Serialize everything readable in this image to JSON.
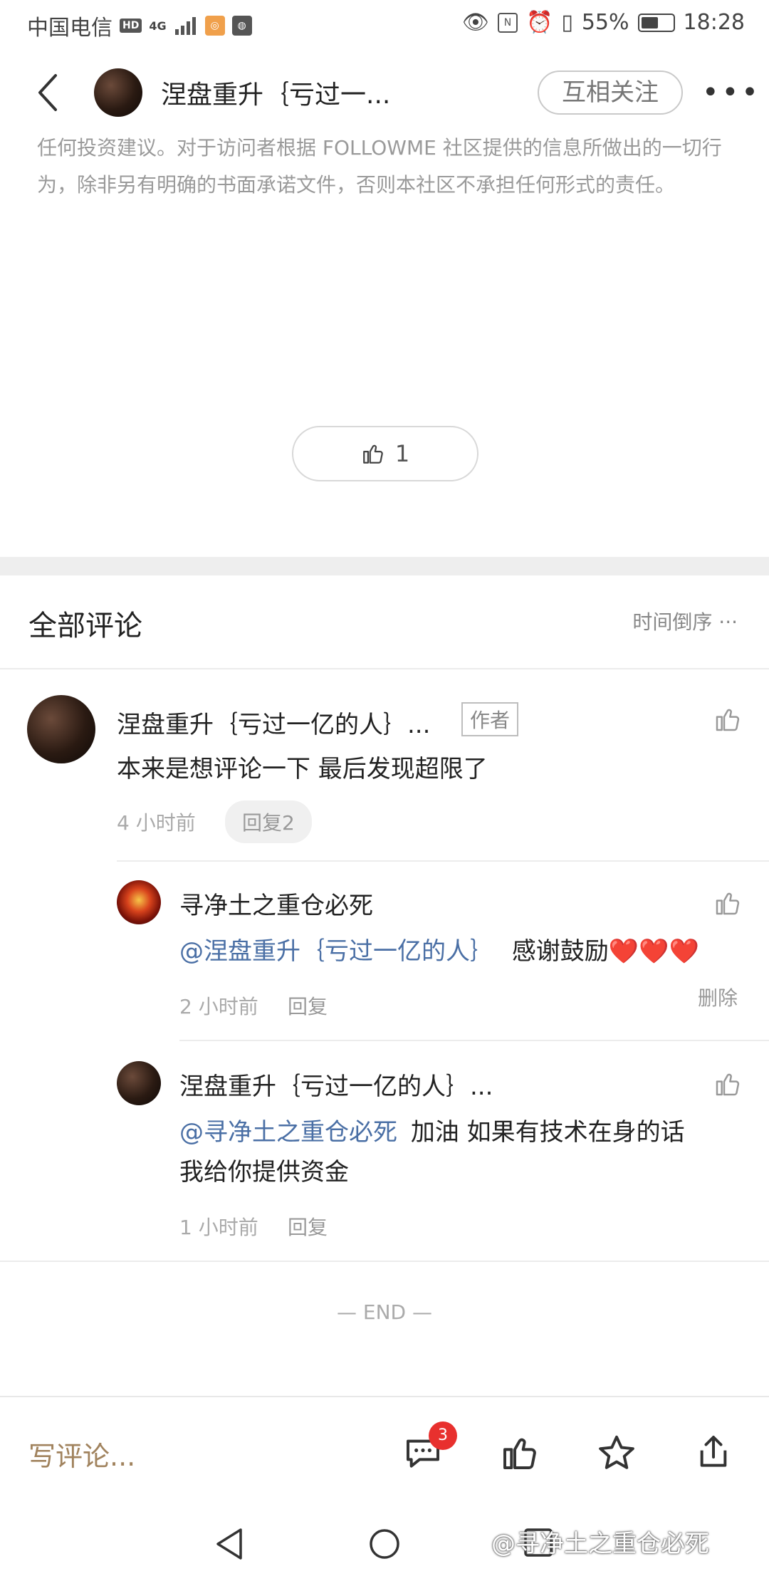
{
  "status_bar": {
    "carrier": "中国电信",
    "hd": "HD",
    "network": "4G",
    "battery_percent": "55%",
    "battery_level": 0.55,
    "time": "18:28"
  },
  "header": {
    "title": "涅盘重升｛亏过一...",
    "follow_label": "互相关注"
  },
  "article": {
    "disclaimer": "任何投资建议。对于访问者根据 FOLLOWME 社区提供的信息所做出的一切行为，除非另有明确的书面承诺文件，否则本社区不承担任何形式的责任。",
    "like_count": "1"
  },
  "comments": {
    "title": "全部评论",
    "sort_label": "时间倒序",
    "main": {
      "author": "涅盘重升｛亏过一亿的人｝...",
      "author_tag": "作者",
      "text": "本来是想评论一下 最后发现超限了",
      "time": "4 小时前",
      "reply_label": "回复2"
    },
    "replies": [
      {
        "author": "寻净土之重仓必死",
        "mention": "@涅盘重升｛亏过一亿的人｝",
        "text": "感谢鼓励❤️❤️❤️",
        "time": "2 小时前",
        "reply_label": "回复",
        "delete_label": "删除"
      },
      {
        "author": "涅盘重升｛亏过一亿的人｝...",
        "mention": "@寻净土之重仓必死",
        "text": "加油 如果有技术在身的话",
        "text2": "我给你提供资金",
        "time": "1 小时前",
        "reply_label": "回复"
      }
    ],
    "end_label": "— END —"
  },
  "bottom_bar": {
    "write_placeholder": "写评论...",
    "comment_badge": "3"
  },
  "watermark": "@寻净土之重仓必死"
}
